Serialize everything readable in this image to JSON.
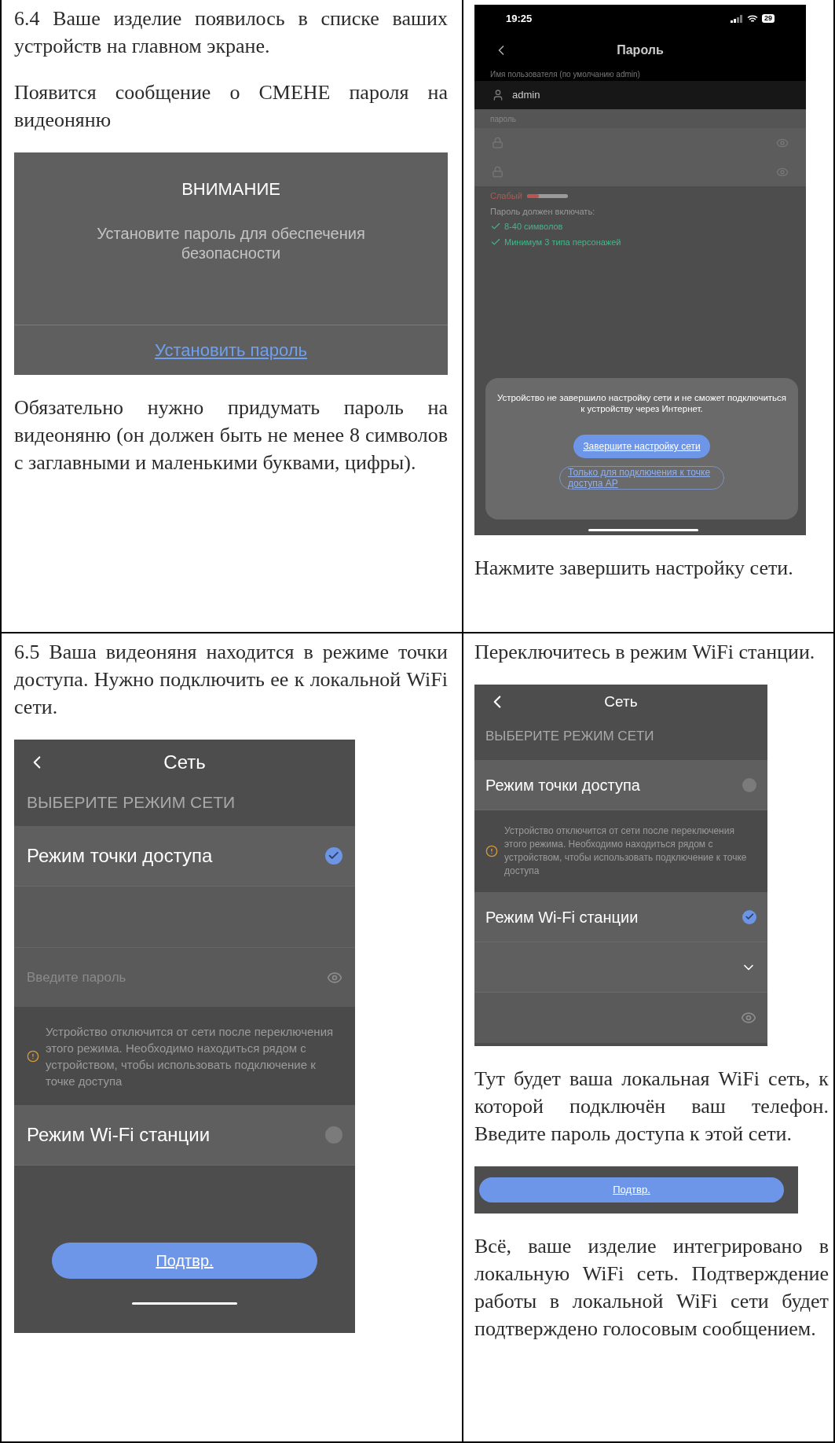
{
  "rows": [
    {
      "cells": [
        {
          "blocks": [
            {
              "kind": "text",
              "text": "6.4 Ваше изделие появилось в списке ваших устройств на главном экране."
            },
            {
              "kind": "text",
              "text": "Появится сообщение о СМЕНЕ пароля на видеоняню"
            },
            {
              "kind": "alert",
              "title": "ВНИМАНИЕ",
              "message": "Установите пароль для обеспечения безопасности",
              "action": "Установить пароль"
            },
            {
              "kind": "text",
              "text": "Обязательно нужно придумать пароль на видеоняню (он должен быть не менее 8 символов с заглавными и маленькими буквами, цифры)."
            }
          ]
        },
        {
          "blocks": [
            {
              "kind": "password_screen",
              "time": "19:25",
              "battery": "29",
              "title": "Пароль",
              "username_label": "Имя пользователя (по умолчанию admin)",
              "username": "admin",
              "password_label": "пароль",
              "strength_label": "Слабый",
              "strength": {
                "level": 0.3
              },
              "requirements_heading": "Пароль должен включать:",
              "requirements": [
                {
                  "text": "8-40 символов",
                  "met": true
                },
                {
                  "text": "Минимум 3 типа персонажей",
                  "met": true
                }
              ],
              "sheet_message": "Устройство не завершило настройку сети и не сможет подключиться к устройству через Интернет.",
              "primary_action": "Завершите настройку сети",
              "secondary_action": "Только для подключения к точке доступа AP"
            },
            {
              "kind": "text",
              "text": "Нажмите завершить настройку сети."
            }
          ]
        }
      ]
    },
    {
      "cells": [
        {
          "blocks": [
            {
              "kind": "text",
              "text": "6.5 Ваша видеоняня находится в режиме точки доступа. Нужно подключить ее к локальной WiFi сети."
            },
            {
              "kind": "network_screen",
              "title": "Сеть",
              "section": "ВЫБЕРИТЕ РЕЖИМ СЕТИ",
              "items": [
                {
                  "kind": "mode",
                  "label": "Режим точки доступа",
                  "selected": true
                },
                {
                  "kind": "blank"
                },
                {
                  "kind": "password",
                  "placeholder": "Введите пароль"
                },
                {
                  "kind": "warning",
                  "text": "Устройство отключится от сети после переключения этого режима. Необходимо находиться рядом с устройством, чтобы использовать подключение к точке доступа"
                },
                {
                  "kind": "mode",
                  "label": "Режим Wi-Fi станции",
                  "selected": false
                }
              ],
              "confirm": "Подтвр."
            }
          ]
        },
        {
          "blocks": [
            {
              "kind": "text",
              "text": "Переключитесь в режим WiFi станции."
            },
            {
              "kind": "network_screen",
              "title": "Сеть",
              "section": "ВЫБЕРИТЕ РЕЖИМ СЕТИ",
              "items": [
                {
                  "kind": "mode",
                  "label": "Режим точки доступа",
                  "selected": false
                },
                {
                  "kind": "warning",
                  "text": "Устройство отключится от сети после переключения этого режима. Необходимо находиться рядом с устройством, чтобы использовать подключение к точке доступа"
                },
                {
                  "kind": "mode",
                  "label": "Режим Wi-Fi станции",
                  "selected": true
                },
                {
                  "kind": "dropdown"
                },
                {
                  "kind": "password"
                }
              ]
            },
            {
              "kind": "text",
              "text": "Тут будет ваша локальная WiFi сеть, к которой подключён ваш телефон. Введите пароль доступа к этой сети."
            },
            {
              "kind": "button_strip",
              "label": "Подтвр."
            },
            {
              "kind": "text",
              "text": "Всё, ваше изделие интегрировано в локальную WiFi сеть. Подтверждение работы в локальной WiFi сети будет подтверждено голосовым сообщением."
            }
          ]
        }
      ]
    }
  ]
}
